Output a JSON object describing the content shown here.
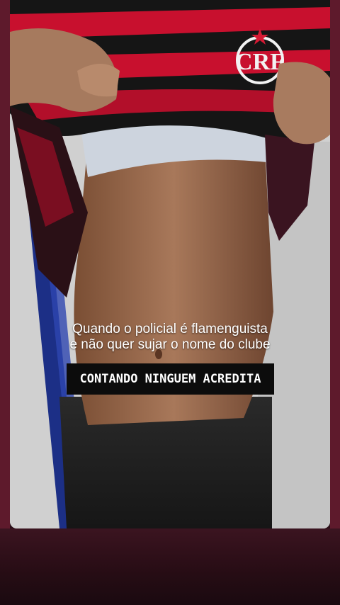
{
  "video": {
    "caption_line1": "Quando o policial é flamenguista",
    "caption_line2": "e não quer sujar o nome do clube",
    "crest_text": "CRF"
  },
  "headline": {
    "text": "CONTANDO NINGUEM ACREDITA"
  },
  "colors": {
    "frame": "#5e1a2c",
    "jersey_red": "#c8102e",
    "jersey_black": "#151515",
    "headline_bg": "#0c0c0c"
  }
}
